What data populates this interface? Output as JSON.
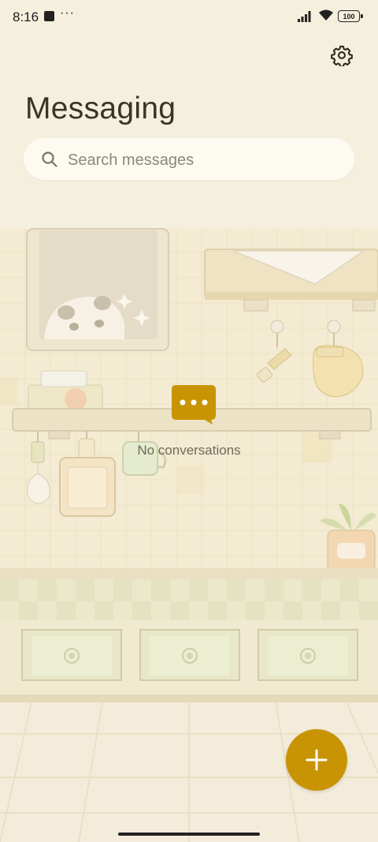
{
  "status_bar": {
    "time": "8:16",
    "overflow": "···",
    "battery": "100"
  },
  "header": {
    "title": "Messaging",
    "settings_icon": "gear-icon"
  },
  "search": {
    "placeholder": "Search messages",
    "icon": "search-icon"
  },
  "empty_state": {
    "icon": "chat-bubble-icon",
    "text": "No conversations"
  },
  "fab": {
    "icon": "plus-icon",
    "color": "#c99403"
  },
  "colors": {
    "background": "#f5efdd",
    "accent": "#c99403",
    "title": "#3b3426"
  }
}
